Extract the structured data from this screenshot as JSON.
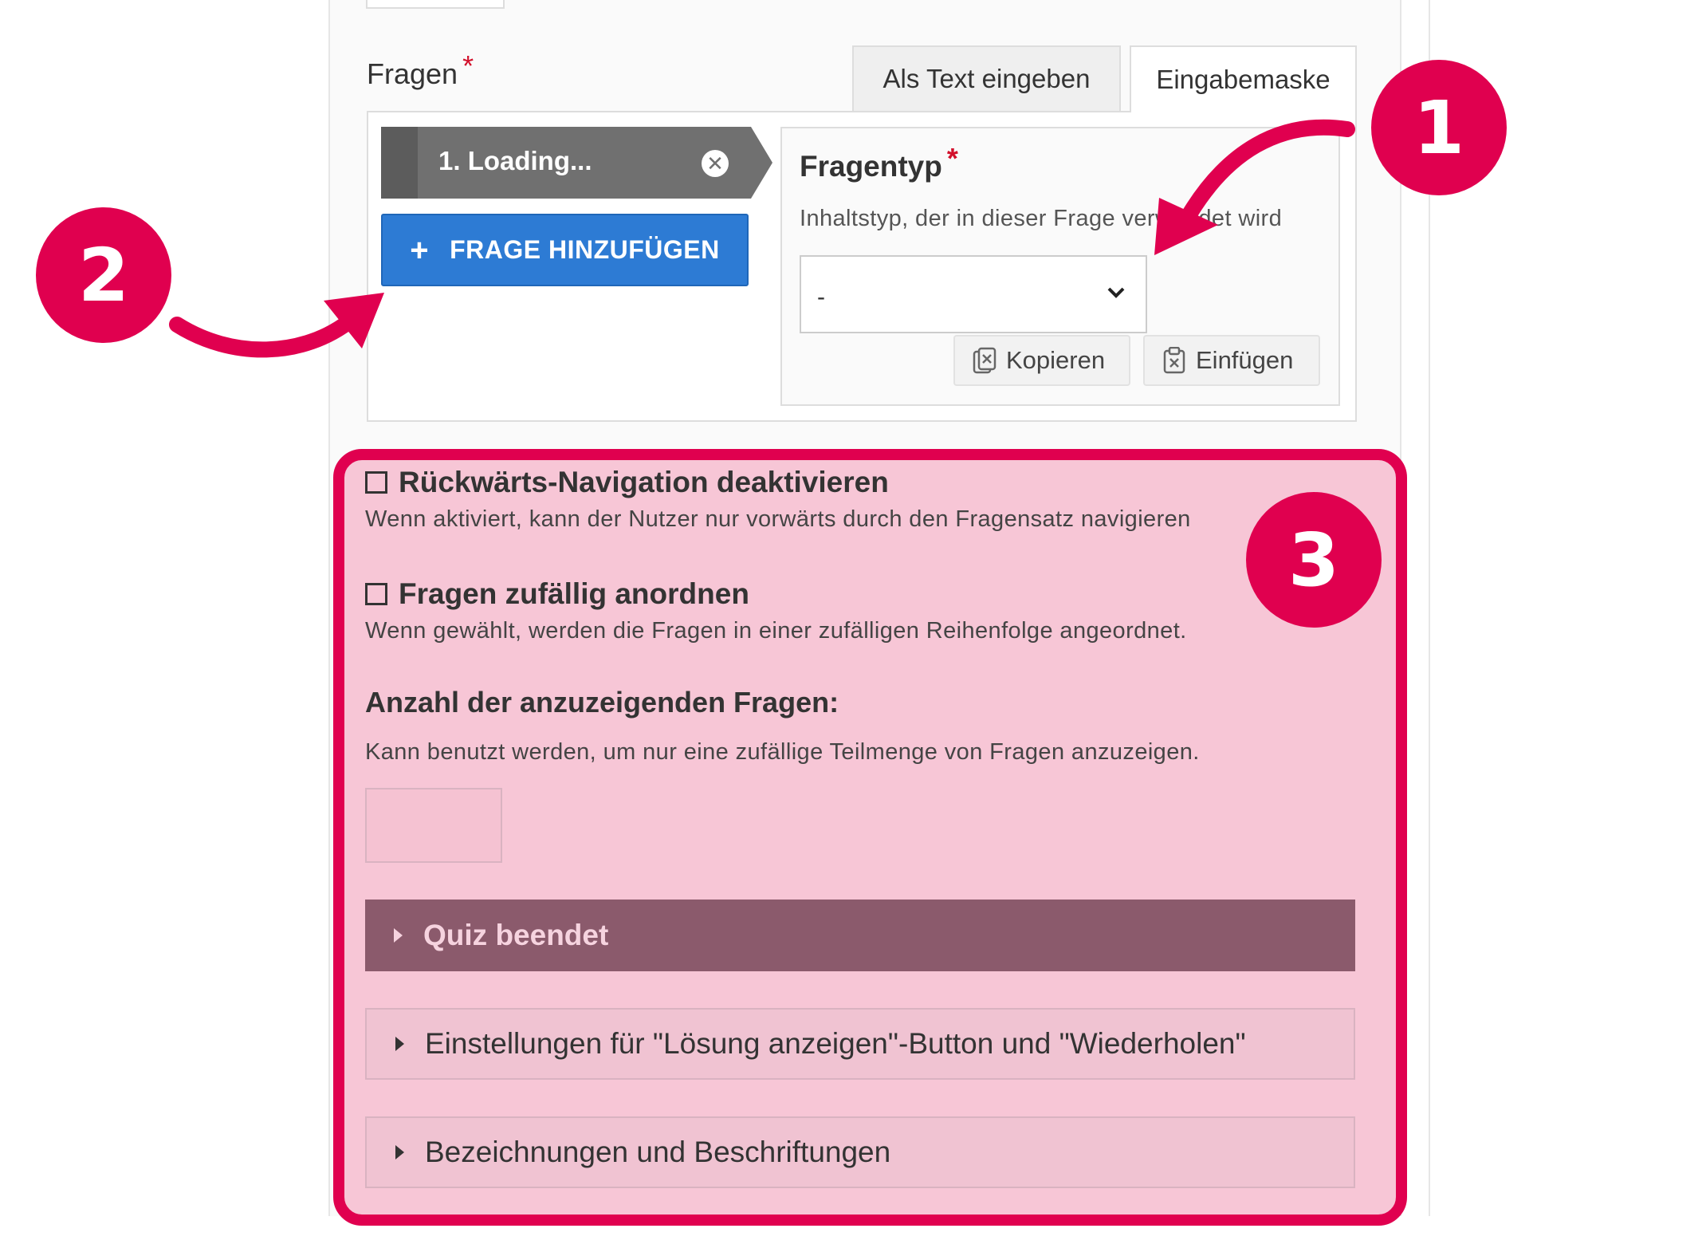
{
  "fragen": {
    "label": "Fragen",
    "required_mark": "*",
    "tabs": [
      {
        "label": "Als Text eingeben"
      },
      {
        "label": "Eingabemaske"
      }
    ]
  },
  "question_list": {
    "items": [
      {
        "label": "1. Loading..."
      }
    ],
    "add_button": "FRAGE HINZUFÜGEN"
  },
  "question_editor": {
    "type_label": "Fragentyp",
    "required_mark": "*",
    "type_description": "Inhaltstyp, der in dieser Frage verwendet wird",
    "select_value": "-",
    "copy_label": "Kopieren",
    "paste_label": "Einfügen"
  },
  "settings": {
    "no_back_nav": {
      "label": "Rückwärts-Navigation deaktivieren",
      "description": "Wenn aktiviert, kann der Nutzer nur vorwärts durch den Fragensatz navigieren",
      "checked": false
    },
    "randomize": {
      "label": "Fragen zufällig anordnen",
      "description": "Wenn gewählt, werden die Fragen in einer zufälligen Reihenfolge angeordnet.",
      "checked": false
    },
    "pool": {
      "label": "Anzahl der anzuzeigenden Fragen:",
      "description": "Kann benutzt werden, um nur eine zufällige Teilmenge von Fragen anzuzeigen.",
      "value": ""
    },
    "accordions": [
      {
        "label": "Quiz beendet"
      },
      {
        "label": "Einstellungen für \"Lösung anzeigen\"-Button und \"Wiederholen\""
      },
      {
        "label": "Bezeichnungen und Beschriftungen"
      }
    ]
  },
  "annotations": [
    {
      "number": "1"
    },
    {
      "number": "2"
    },
    {
      "number": "3"
    }
  ],
  "colors": {
    "accent": "#e0004f",
    "highlight_bg": "#f7c6d6",
    "primary_button": "#2d7bd4",
    "accordion_dark": "#8b5a6c"
  }
}
